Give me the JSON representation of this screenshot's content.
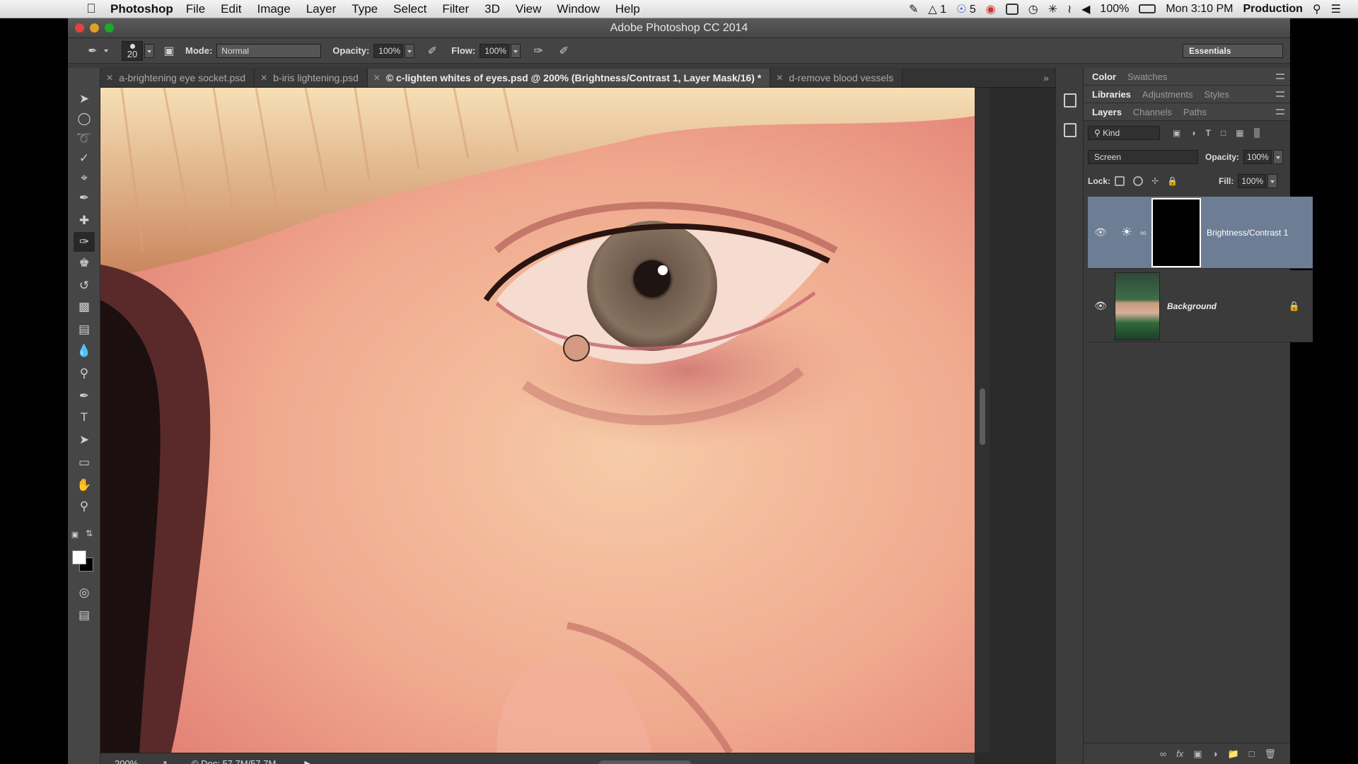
{
  "menubar": {
    "app": "Photoshop",
    "menus": [
      "File",
      "Edit",
      "Image",
      "Layer",
      "Type",
      "Select",
      "Filter",
      "3D",
      "View",
      "Window",
      "Help"
    ],
    "status": {
      "adobe_count": "1",
      "cc_count": "5",
      "battery": "100%",
      "clock": "Mon 3:10 PM",
      "user": "Production"
    }
  },
  "window": {
    "title": "Adobe Photoshop CC 2014"
  },
  "options": {
    "brush_size": "20",
    "mode_label": "Mode:",
    "mode_value": "Normal",
    "opacity_label": "Opacity:",
    "opacity_value": "100%",
    "flow_label": "Flow:",
    "flow_value": "100%",
    "workspace": "Essentials"
  },
  "tabs": [
    {
      "label": "a-brightening eye socket.psd",
      "active": false
    },
    {
      "label": "b-iris lightening.psd",
      "active": false
    },
    {
      "label": "© c-lighten whites of eyes.psd @ 200% (Brightness/Contrast 1, Layer Mask/16) *",
      "active": true
    },
    {
      "label": "d-remove blood vessels",
      "active": false
    }
  ],
  "status": {
    "zoom": "200%",
    "doc": "© Doc: 57.7M/57.7M"
  },
  "panels": {
    "top_tabs": [
      "Color",
      "Swatches"
    ],
    "mid_tabs": [
      "Libraries",
      "Adjustments",
      "Styles"
    ],
    "layer_tabs": [
      "Layers",
      "Channels",
      "Paths"
    ],
    "kind_label": "Kind",
    "blend_mode": "Screen",
    "opacity_label": "Opacity:",
    "opacity_value": "100%",
    "lock_label": "Lock:",
    "fill_label": "Fill:",
    "fill_value": "100%"
  },
  "layers": [
    {
      "name": "Brightness/Contrast 1",
      "selected": true
    },
    {
      "name": "Background",
      "selected": false
    }
  ],
  "colors": {
    "accent_selected_layer": "#6d7d94",
    "panel_bg": "#3b3b3b",
    "foreground": "#ffffff",
    "background": "#000000"
  }
}
